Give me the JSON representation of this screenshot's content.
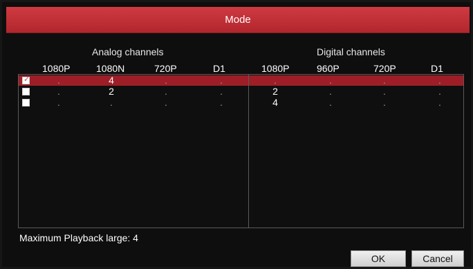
{
  "dialog": {
    "title": "Mode"
  },
  "analog": {
    "title": "Analog channels",
    "columns": [
      "1080P",
      "1080N",
      "720P",
      "D1"
    ],
    "rows": [
      {
        "checked": true,
        "cells": [
          ".",
          "4",
          ".",
          "."
        ]
      },
      {
        "checked": false,
        "cells": [
          ".",
          "2",
          ".",
          "."
        ]
      },
      {
        "checked": false,
        "cells": [
          ".",
          ".",
          ".",
          "."
        ]
      }
    ]
  },
  "digital": {
    "title": "Digital channels",
    "columns": [
      "1080P",
      "960P",
      "720P",
      "D1"
    ],
    "rows": [
      {
        "cells": [
          ".",
          ".",
          ".",
          "."
        ]
      },
      {
        "cells": [
          "2",
          ".",
          ".",
          "."
        ]
      },
      {
        "cells": [
          "4",
          ".",
          ".",
          "."
        ]
      }
    ]
  },
  "footer": {
    "max_playback": "Maximum Playback large: 4",
    "ok_label": "OK",
    "cancel_label": "Cancel"
  },
  "colors": {
    "title_bar": "#c1313a",
    "selected_row": "#9d1e27",
    "background": "#0e0e0e"
  }
}
